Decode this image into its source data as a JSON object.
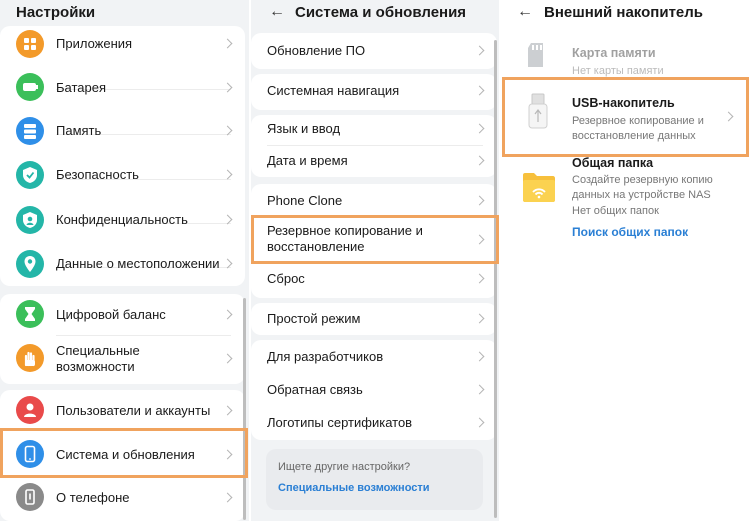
{
  "panel1": {
    "title": "Настройки",
    "items": [
      {
        "label": "Приложения",
        "color": "#f39a2a",
        "icon": "apps-icon"
      },
      {
        "label": "Батарея",
        "color": "#3bbf5a",
        "icon": "battery-icon"
      },
      {
        "label": "Память",
        "color": "#2f8fe8",
        "icon": "storage-icon"
      },
      {
        "label": "Безопасность",
        "color": "#24b6a8",
        "icon": "shield-icon"
      },
      {
        "label": "Конфиденциальность",
        "color": "#24b6a8",
        "icon": "privacy-icon"
      },
      {
        "label": "Данные о местоположении",
        "color": "#24b6a8",
        "icon": "location-icon"
      },
      {
        "label": "Цифровой баланс",
        "color": "#3bbf5a",
        "icon": "hourglass-icon"
      },
      {
        "label": "Специальные возможности",
        "color": "#f39a2a",
        "icon": "hand-icon"
      },
      {
        "label": "Пользователи и аккаунты",
        "color": "#e94a4a",
        "icon": "user-icon"
      },
      {
        "label": "Система и обновления",
        "color": "#2f8fe8",
        "icon": "phone-icon"
      },
      {
        "label": "О телефоне",
        "color": "#8a8a8a",
        "icon": "info-icon"
      }
    ]
  },
  "panel2": {
    "title": "Система и обновления",
    "items": [
      {
        "label": "Обновление ПО"
      },
      {
        "label": "Системная навигация"
      },
      {
        "label": "Язык и ввод"
      },
      {
        "label": "Дата и время"
      },
      {
        "label": "Phone Clone"
      },
      {
        "label": "Резервное копирование и восстановление"
      },
      {
        "label": "Сброс"
      },
      {
        "label": "Простой режим"
      },
      {
        "label": "Для разработчиков"
      },
      {
        "label": "Обратная связь"
      },
      {
        "label": "Логотипы сертификатов"
      }
    ],
    "suggest": {
      "question": "Ищете другие настройки?",
      "link": "Специальные возможности"
    }
  },
  "panel3": {
    "title": "Внешний накопитель",
    "items": [
      {
        "title": "Карта памяти",
        "subtitle": "Нет карты памяти",
        "icon": "sd-card-icon"
      },
      {
        "title": "USB-накопитель",
        "subtitle": "Резервное копирование и восстановление данных",
        "icon": "usb-drive-icon"
      },
      {
        "title": "Общая папка",
        "subtitle": "Создайте резервную копию данных на устройстве NAS",
        "subtitle2": "Нет общих папок",
        "link": "Поиск общих папок",
        "icon": "folder-wifi-icon"
      }
    ]
  },
  "colors": {
    "highlight": "#f0a35e",
    "link": "#2a7fd4",
    "background": "#f1f3f5"
  }
}
